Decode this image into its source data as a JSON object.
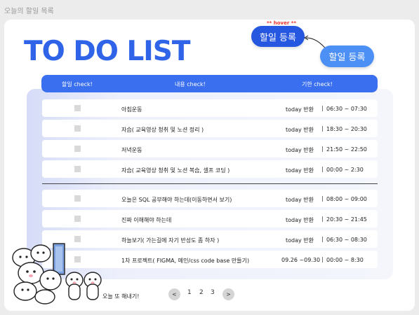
{
  "frame_label": "오늘의 할일 목록",
  "title": "TO DO LIST",
  "hover_tag": "** hover **",
  "buttons": {
    "add_hover": "할일 등록",
    "add": "할일 등록"
  },
  "columns": [
    "할일 check!",
    "내용 check!",
    "기한 check!"
  ],
  "rows": [
    {
      "content": "아침운동",
      "due": "today 반환",
      "time": "06:30 ~ 07:30"
    },
    {
      "content": "자습( 교육영상 청취 및 노션 정리 )",
      "due": "today 반환",
      "time": "18:30 ~ 20:30"
    },
    {
      "content": "저녁운동",
      "due": "today 반환",
      "time": "21:50 ~ 22:50"
    },
    {
      "content": "자습( 교육영상 청취 및 노션 복습, 셀프 코딩 )",
      "due": "today 반환",
      "time": "00:00 ~ 2:30"
    },
    {
      "content": "오늘은 SQL 공부해야 하는데(이동하면서 보기)",
      "due": "today 반환",
      "time": "08:00 ~ 09:00"
    },
    {
      "content": "진짜 이해해야 하는데",
      "due": "today 반환",
      "time": "20:30 ~ 21:45"
    },
    {
      "content": "하늘보기( 가는길에 자기 반성도 좀 하자 )",
      "due": "today 반환",
      "time": "06:30 ~ 08:30"
    },
    {
      "content": "1차 프로젝트( FIGMA, 메인/css code base 만들기)",
      "due": "09.26 ~09.30",
      "time": "00:00 ~ 8:30"
    }
  ],
  "pagination": {
    "prev": "<",
    "pages": [
      "1",
      "2",
      "3"
    ],
    "next": ">"
  },
  "footer_text": "오늘 또 해내기!",
  "colors": {
    "primary": "#2f63e8",
    "header": "#3a6ff0",
    "button_hover": "#2557e0",
    "button": "#4c8ff5",
    "hover_tag": "#e8332d"
  }
}
